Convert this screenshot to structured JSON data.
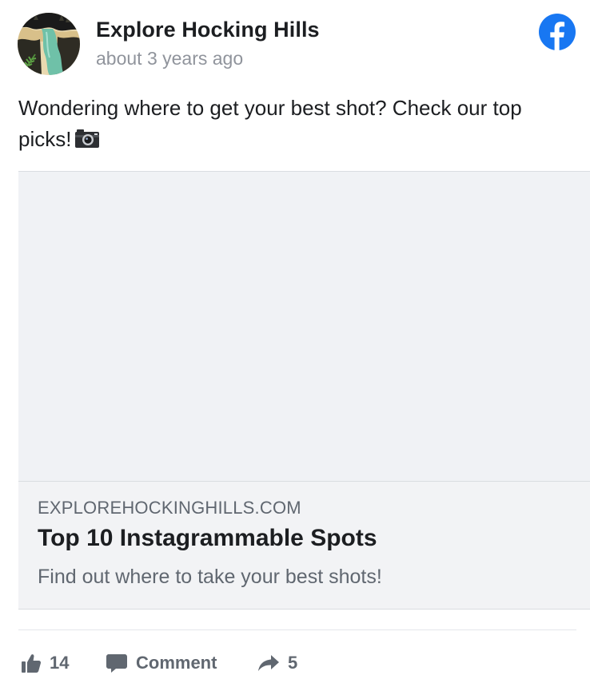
{
  "post": {
    "page_name": "Explore Hocking Hills",
    "timestamp": "about 3 years ago",
    "message": "Wondering where to get your best shot? Check our top picks!",
    "avatar_icon": "waterfall-landscape-avatar",
    "brand_icon": "facebook-logo-icon",
    "emoji_icon": "camera-icon"
  },
  "link_preview": {
    "domain": "EXPLOREHOCKINGHILLS.COM",
    "title": "Top 10 Instagrammable Spots",
    "description": "Find out where to take your best shots!"
  },
  "actions": {
    "like_count": "14",
    "comment_label": "Comment",
    "share_count": "5"
  },
  "colors": {
    "facebook_blue": "#1877f2",
    "text_primary": "#1c1e21",
    "text_secondary": "#606770",
    "timestamp_gray": "#90949c",
    "card_background": "#f2f3f5",
    "icon_gray": "#606770"
  }
}
